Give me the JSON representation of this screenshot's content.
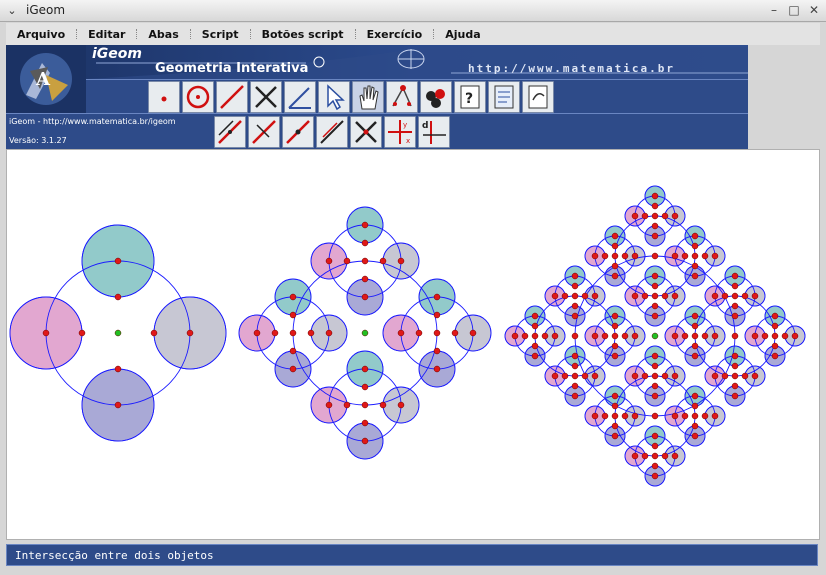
{
  "window": {
    "title": "iGeom",
    "menu_icon": "chevron-down",
    "minimize_glyph": "–",
    "maximize_glyph": "□",
    "close_glyph": "✕"
  },
  "menu": [
    "Arquivo",
    "Editar",
    "Abas",
    "Script",
    "Botões script",
    "Exercício",
    "Ajuda"
  ],
  "banner": {
    "name": "iGeom",
    "subtitle": "Geometria Interativa",
    "url": "http://www.matematica.br",
    "info_line1": "iGeom - http://www.matematica.br/igeom",
    "info_line2": "Versão: 3.1.27"
  },
  "toolbar1": [
    "point-icon",
    "circle-icon",
    "line-icon",
    "intersection-icon",
    "angle-icon",
    "arrow-select-icon",
    "hand-icon",
    "construction-icon",
    "paint-icon",
    "help-doc-icon",
    "edit-doc-icon",
    "export-doc-icon"
  ],
  "toolbar2": [
    "parallel-icon",
    "perpendicular-icon",
    "midpoint-icon",
    "bisector-icon",
    "erase-icon",
    "axes-icon",
    "distance-icon"
  ],
  "colors": {
    "circle_blue": "#1a1aff",
    "fill_teal": "#6db8b8",
    "fill_pink": "#d889c0",
    "fill_grey": "#b4b4c4",
    "fill_violet": "#8c8cc8",
    "point_red": "#e01818",
    "point_green": "#22c022"
  },
  "status": {
    "text": "Intersecção entre dois objetos"
  }
}
